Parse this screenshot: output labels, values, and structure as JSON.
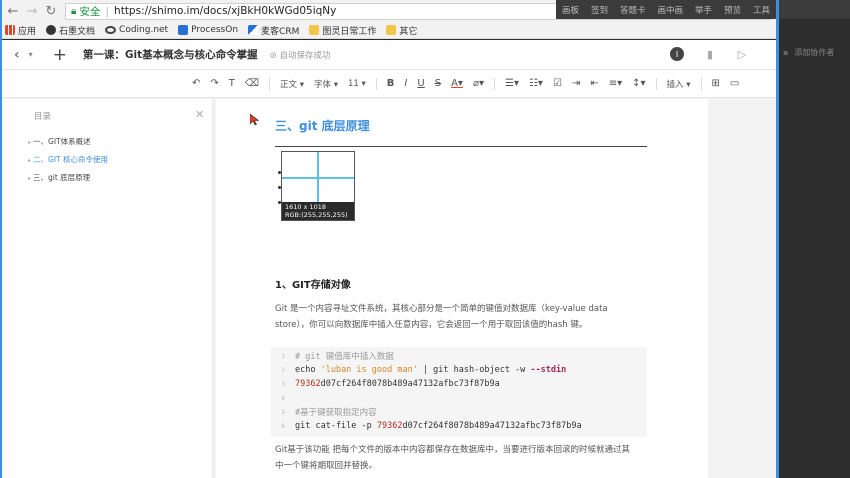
{
  "browser": {
    "secure_label": "安全",
    "url": "https://shimo.im/docs/xjBkH0kWGd05iqNy"
  },
  "bookmarks": [
    {
      "label": "应用",
      "icon": "apps-grid-icon",
      "color": "#e0452c"
    },
    {
      "label": "石墨文档",
      "icon": "shimo-logo-icon",
      "color": "#333333"
    },
    {
      "label": "Coding.net",
      "icon": "coding-logo-icon",
      "color": "#444444"
    },
    {
      "label": "ProcessOn",
      "icon": "processon-logo-icon",
      "color": "#2a6fd6"
    },
    {
      "label": "麦客CRM",
      "icon": "mike-logo-icon",
      "color": "#2a6fd6"
    },
    {
      "label": "图灵日常工作",
      "icon": "folder-icon",
      "color": "#f2c54b"
    },
    {
      "label": "其它",
      "icon": "folder-icon",
      "color": "#f2c54b"
    }
  ],
  "overlay_menu": [
    "画板",
    "签到",
    "答题卡",
    "画中画",
    "举手",
    "预览",
    "工具"
  ],
  "doc": {
    "title": "第一课：Git基本概念与核心命令掌握",
    "saved_status": "自动保存成功",
    "collab_label": "添加协作者",
    "avatar_letter": "I"
  },
  "toolbar": {
    "paragraph": "正文",
    "font": "字体",
    "size": "11",
    "insert": "插入"
  },
  "outline": {
    "title": "目录",
    "items": [
      {
        "label": "一、GIT体系概述",
        "active": false
      },
      {
        "label": "二、GIT 核心命令使用",
        "active": true
      },
      {
        "label": "三、git 底层原理",
        "active": false
      }
    ]
  },
  "content": {
    "heading": "三、git 底层原理",
    "screenshot_info_line1": "1610 x 1018",
    "screenshot_info_line2": "RGB:(255,255,255)",
    "subheading": "1、GIT存储对像",
    "para1_line1": "Git 是一个内容寻址文件系统，其核心部分是一个简单的键值对数据库（key-value data",
    "para1_line2": "store），你可以向数据库中插入任意内容，它会返回一个用于取回该值的hash 键。",
    "code": {
      "line1": "# git 键值库中插入数据",
      "line2_cmd": "echo ",
      "line2_str": "'luban is good man'",
      "line2_mid": " | git hash-object -w ",
      "line2_kw": "--stdin",
      "line3_num": "79362",
      "line3_rest": "d07cf264f8078b489a47132afbc73f87b9a",
      "line5": "#基于键获取指定内容",
      "line6_cmd": "git cat-file -p ",
      "line6_num": "79362",
      "line6_rest": "d07cf264f8078b489a47132afbc73f87b9a",
      "line_numbers": [
        "1",
        "2",
        "3",
        "4",
        "5",
        "6"
      ]
    },
    "para2_line1": "Git基于该功能 把每个文件的版本中内容都保存在数据库中，当要进行版本回滚的时候就通过其",
    "para2_line2": "中一个键将期取回并替换。"
  }
}
